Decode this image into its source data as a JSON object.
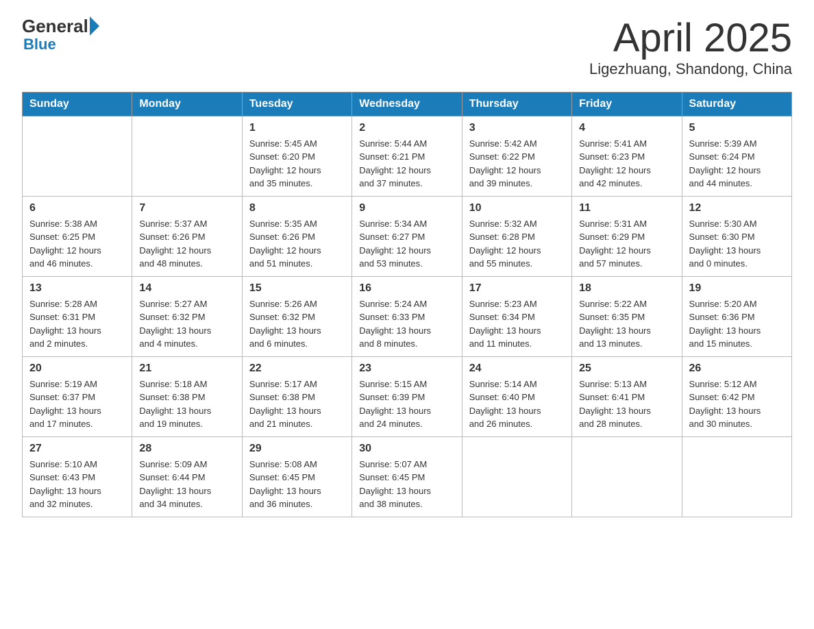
{
  "header": {
    "logo": {
      "general": "General",
      "blue": "Blue"
    },
    "title": "April 2025",
    "location": "Ligezhuang, Shandong, China"
  },
  "calendar": {
    "days_of_week": [
      "Sunday",
      "Monday",
      "Tuesday",
      "Wednesday",
      "Thursday",
      "Friday",
      "Saturday"
    ],
    "weeks": [
      [
        {
          "day": "",
          "info": ""
        },
        {
          "day": "",
          "info": ""
        },
        {
          "day": "1",
          "info": "Sunrise: 5:45 AM\nSunset: 6:20 PM\nDaylight: 12 hours\nand 35 minutes."
        },
        {
          "day": "2",
          "info": "Sunrise: 5:44 AM\nSunset: 6:21 PM\nDaylight: 12 hours\nand 37 minutes."
        },
        {
          "day": "3",
          "info": "Sunrise: 5:42 AM\nSunset: 6:22 PM\nDaylight: 12 hours\nand 39 minutes."
        },
        {
          "day": "4",
          "info": "Sunrise: 5:41 AM\nSunset: 6:23 PM\nDaylight: 12 hours\nand 42 minutes."
        },
        {
          "day": "5",
          "info": "Sunrise: 5:39 AM\nSunset: 6:24 PM\nDaylight: 12 hours\nand 44 minutes."
        }
      ],
      [
        {
          "day": "6",
          "info": "Sunrise: 5:38 AM\nSunset: 6:25 PM\nDaylight: 12 hours\nand 46 minutes."
        },
        {
          "day": "7",
          "info": "Sunrise: 5:37 AM\nSunset: 6:26 PM\nDaylight: 12 hours\nand 48 minutes."
        },
        {
          "day": "8",
          "info": "Sunrise: 5:35 AM\nSunset: 6:26 PM\nDaylight: 12 hours\nand 51 minutes."
        },
        {
          "day": "9",
          "info": "Sunrise: 5:34 AM\nSunset: 6:27 PM\nDaylight: 12 hours\nand 53 minutes."
        },
        {
          "day": "10",
          "info": "Sunrise: 5:32 AM\nSunset: 6:28 PM\nDaylight: 12 hours\nand 55 minutes."
        },
        {
          "day": "11",
          "info": "Sunrise: 5:31 AM\nSunset: 6:29 PM\nDaylight: 12 hours\nand 57 minutes."
        },
        {
          "day": "12",
          "info": "Sunrise: 5:30 AM\nSunset: 6:30 PM\nDaylight: 13 hours\nand 0 minutes."
        }
      ],
      [
        {
          "day": "13",
          "info": "Sunrise: 5:28 AM\nSunset: 6:31 PM\nDaylight: 13 hours\nand 2 minutes."
        },
        {
          "day": "14",
          "info": "Sunrise: 5:27 AM\nSunset: 6:32 PM\nDaylight: 13 hours\nand 4 minutes."
        },
        {
          "day": "15",
          "info": "Sunrise: 5:26 AM\nSunset: 6:32 PM\nDaylight: 13 hours\nand 6 minutes."
        },
        {
          "day": "16",
          "info": "Sunrise: 5:24 AM\nSunset: 6:33 PM\nDaylight: 13 hours\nand 8 minutes."
        },
        {
          "day": "17",
          "info": "Sunrise: 5:23 AM\nSunset: 6:34 PM\nDaylight: 13 hours\nand 11 minutes."
        },
        {
          "day": "18",
          "info": "Sunrise: 5:22 AM\nSunset: 6:35 PM\nDaylight: 13 hours\nand 13 minutes."
        },
        {
          "day": "19",
          "info": "Sunrise: 5:20 AM\nSunset: 6:36 PM\nDaylight: 13 hours\nand 15 minutes."
        }
      ],
      [
        {
          "day": "20",
          "info": "Sunrise: 5:19 AM\nSunset: 6:37 PM\nDaylight: 13 hours\nand 17 minutes."
        },
        {
          "day": "21",
          "info": "Sunrise: 5:18 AM\nSunset: 6:38 PM\nDaylight: 13 hours\nand 19 minutes."
        },
        {
          "day": "22",
          "info": "Sunrise: 5:17 AM\nSunset: 6:38 PM\nDaylight: 13 hours\nand 21 minutes."
        },
        {
          "day": "23",
          "info": "Sunrise: 5:15 AM\nSunset: 6:39 PM\nDaylight: 13 hours\nand 24 minutes."
        },
        {
          "day": "24",
          "info": "Sunrise: 5:14 AM\nSunset: 6:40 PM\nDaylight: 13 hours\nand 26 minutes."
        },
        {
          "day": "25",
          "info": "Sunrise: 5:13 AM\nSunset: 6:41 PM\nDaylight: 13 hours\nand 28 minutes."
        },
        {
          "day": "26",
          "info": "Sunrise: 5:12 AM\nSunset: 6:42 PM\nDaylight: 13 hours\nand 30 minutes."
        }
      ],
      [
        {
          "day": "27",
          "info": "Sunrise: 5:10 AM\nSunset: 6:43 PM\nDaylight: 13 hours\nand 32 minutes."
        },
        {
          "day": "28",
          "info": "Sunrise: 5:09 AM\nSunset: 6:44 PM\nDaylight: 13 hours\nand 34 minutes."
        },
        {
          "day": "29",
          "info": "Sunrise: 5:08 AM\nSunset: 6:45 PM\nDaylight: 13 hours\nand 36 minutes."
        },
        {
          "day": "30",
          "info": "Sunrise: 5:07 AM\nSunset: 6:45 PM\nDaylight: 13 hours\nand 38 minutes."
        },
        {
          "day": "",
          "info": ""
        },
        {
          "day": "",
          "info": ""
        },
        {
          "day": "",
          "info": ""
        }
      ]
    ]
  }
}
